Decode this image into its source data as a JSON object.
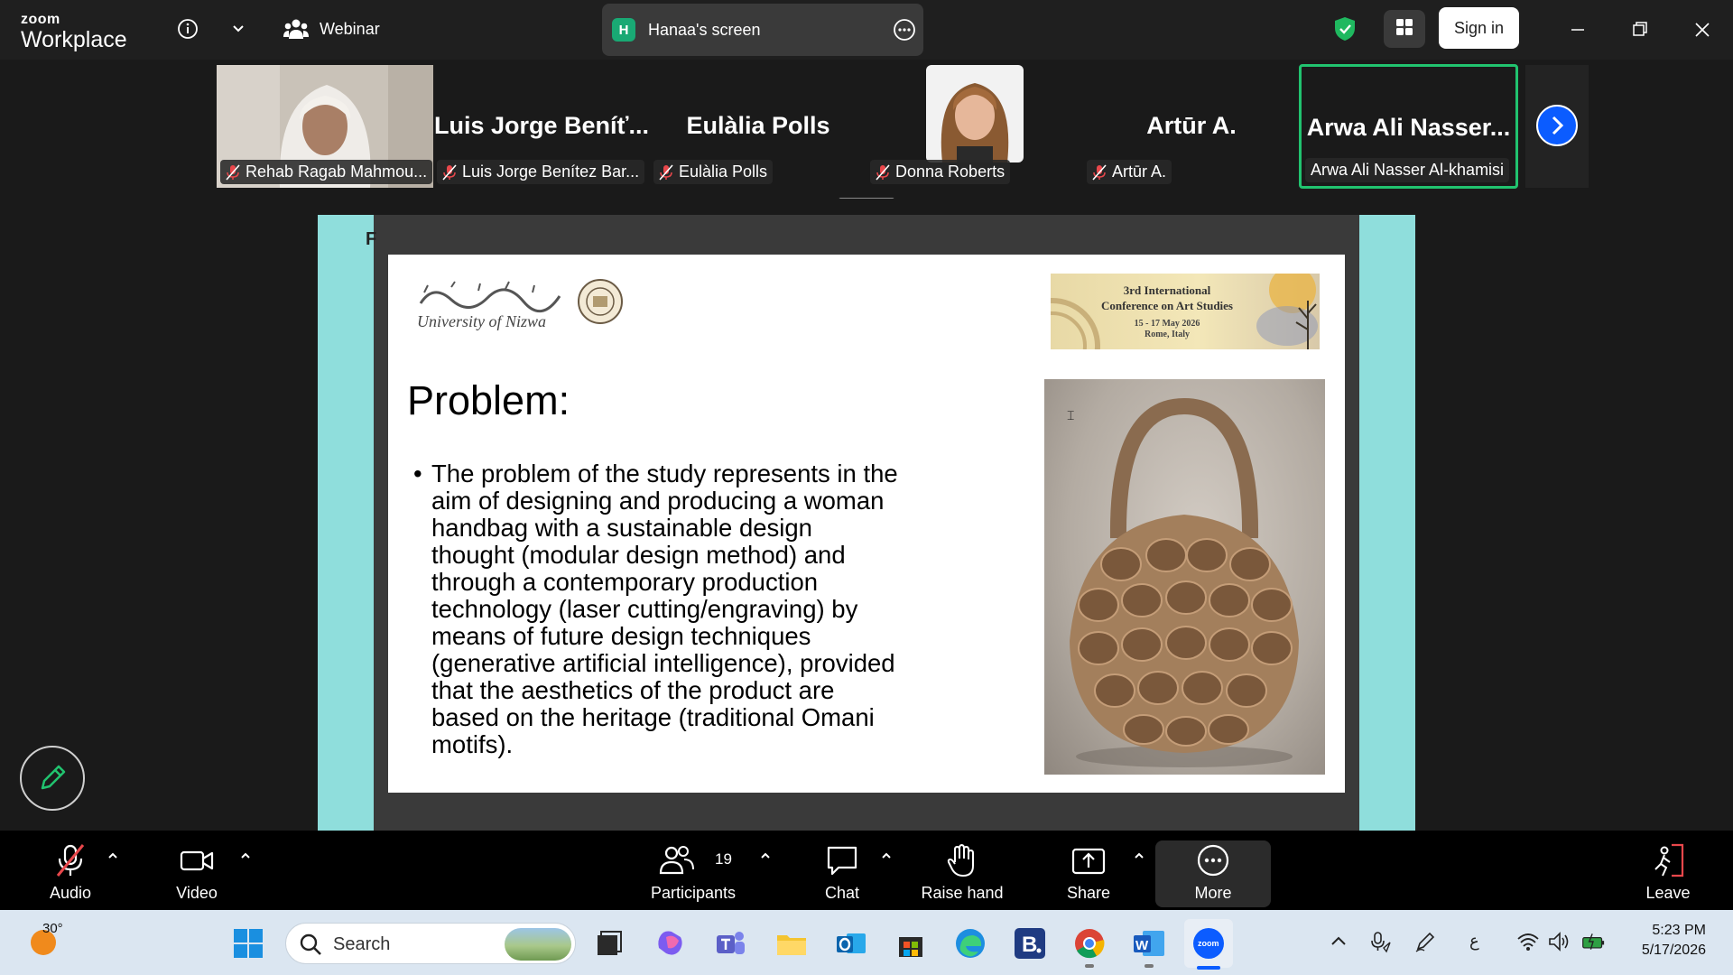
{
  "titlebar": {
    "brand_line1": "zoom",
    "brand_line2": "Workplace",
    "webinar_label": "Webinar",
    "share_badge": "H",
    "share_label": "Hanaa's screen",
    "signin_label": "Sign in"
  },
  "participants": [
    {
      "name": "Rehab Ragab Mahmou...",
      "big_name": "",
      "muted": true,
      "video": true
    },
    {
      "name": "Luis Jorge Benítez Bar...",
      "big_name": "Luis Jorge Beníť...",
      "muted": true,
      "video": false
    },
    {
      "name": "Eulàlia Polls",
      "big_name": "Eulàlia Polls",
      "muted": true,
      "video": false
    },
    {
      "name": "Donna Roberts",
      "big_name": "",
      "muted": true,
      "video": true
    },
    {
      "name": "Artūr A.",
      "big_name": "Artūr A.",
      "muted": true,
      "video": false
    },
    {
      "name": "Arwa Ali Nasser Al-khamisi",
      "big_name": "Arwa  Ali  Nasser...",
      "muted": false,
      "video": false,
      "active_speaker": true
    }
  ],
  "slide": {
    "cut_letter": "F",
    "university_name": "University of Nizwa",
    "conference": {
      "line1": "3rd International",
      "line2": "Conference on Art Studies",
      "line3": "15 - 17 May 2026",
      "line4": "Rome, Italy"
    },
    "title": "Problem:",
    "bullet_text": "The problem of the study represents in the aim of designing and producing a woman handbag with a sustainable design thought (modular design method) and through a contemporary production technology (laser cutting/engraving) by means of future design techniques (generative artificial intelligence), provided that the aesthetics of the product are based on the heritage (traditional Omani motifs)."
  },
  "controls": {
    "audio": "Audio",
    "video": "Video",
    "participants": "Participants",
    "participants_count": "19",
    "chat": "Chat",
    "raise_hand": "Raise hand",
    "share": "Share",
    "more": "More",
    "leave": "Leave"
  },
  "taskbar": {
    "temperature": "30°",
    "search_placeholder": "Search",
    "ime_indicator": "ع",
    "time": "5:23 PM",
    "date": "5/17/2026"
  },
  "colors": {
    "accent_blue": "#0b5cff",
    "active_speaker_border": "#21c36f",
    "slide_side_bars": "#8fdedc",
    "muted_red": "#e8474b"
  }
}
